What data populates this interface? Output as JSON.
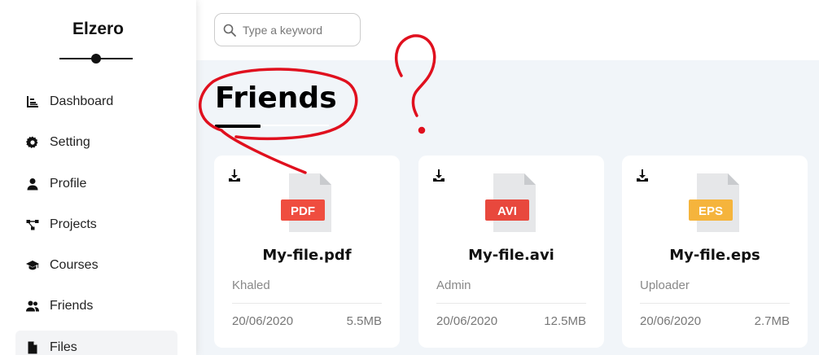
{
  "brand": {
    "name": "Elzero"
  },
  "sidebar": {
    "items": [
      {
        "label": "Dashboard",
        "icon": "chart-bar-icon"
      },
      {
        "label": "Setting",
        "icon": "gear-icon"
      },
      {
        "label": "Profile",
        "icon": "user-icon"
      },
      {
        "label": "Projects",
        "icon": "diagram-icon"
      },
      {
        "label": "Courses",
        "icon": "graduation-cap-icon"
      },
      {
        "label": "Friends",
        "icon": "users-icon"
      },
      {
        "label": "Files",
        "icon": "file-icon",
        "active": true
      }
    ]
  },
  "search": {
    "placeholder": "Type a keyword",
    "value": ""
  },
  "page": {
    "title": "Friends"
  },
  "files": [
    {
      "name": "My-file.pdf",
      "ext": "PDF",
      "color": "#ef4d3f",
      "owner": "Khaled",
      "date": "20/06/2020",
      "size": "5.5MB"
    },
    {
      "name": "My-file.avi",
      "ext": "AVI",
      "color": "#e8483d",
      "owner": "Admin",
      "date": "20/06/2020",
      "size": "12.5MB"
    },
    {
      "name": "My-file.eps",
      "ext": "EPS",
      "color": "#f5b43c",
      "owner": "Uploader",
      "date": "20/06/2020",
      "size": "2.7MB"
    }
  ],
  "colors": {
    "annotation": "#e0101e",
    "background": "#f1f5f9"
  }
}
